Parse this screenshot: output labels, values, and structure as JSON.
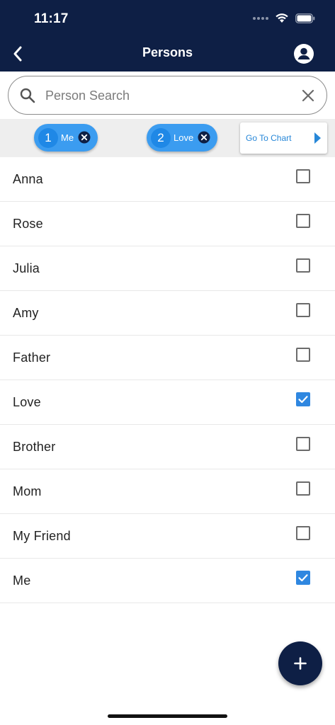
{
  "status_bar": {
    "time": "11:17"
  },
  "header": {
    "title": "Persons"
  },
  "search": {
    "placeholder": "Person Search",
    "value": ""
  },
  "chips": [
    {
      "number": "1",
      "label": "Me"
    },
    {
      "number": "2",
      "label": "Love"
    }
  ],
  "go_to_chart": {
    "label": "Go To Chart"
  },
  "persons": [
    {
      "name": "Anna",
      "checked": false
    },
    {
      "name": "Rose",
      "checked": false
    },
    {
      "name": "Julia",
      "checked": false
    },
    {
      "name": "Amy",
      "checked": false
    },
    {
      "name": "Father",
      "checked": false
    },
    {
      "name": "Love",
      "checked": true
    },
    {
      "name": "Brother",
      "checked": false
    },
    {
      "name": "Mom",
      "checked": false
    },
    {
      "name": "My Friend",
      "checked": false
    },
    {
      "name": "Me",
      "checked": true
    }
  ],
  "colors": {
    "header_bg": "#0e1f45",
    "accent": "#3b9cf0",
    "checkbox_checked": "#2f87e0",
    "chip_bar_bg": "#eeeeee"
  },
  "icons": {
    "back": "chevron-left-icon",
    "account": "account-circle-icon",
    "search": "search-icon",
    "clear": "close-icon",
    "chip_remove": "cancel-circle-icon",
    "go_chart": "play-arrow-icon",
    "fab": "plus-icon"
  }
}
